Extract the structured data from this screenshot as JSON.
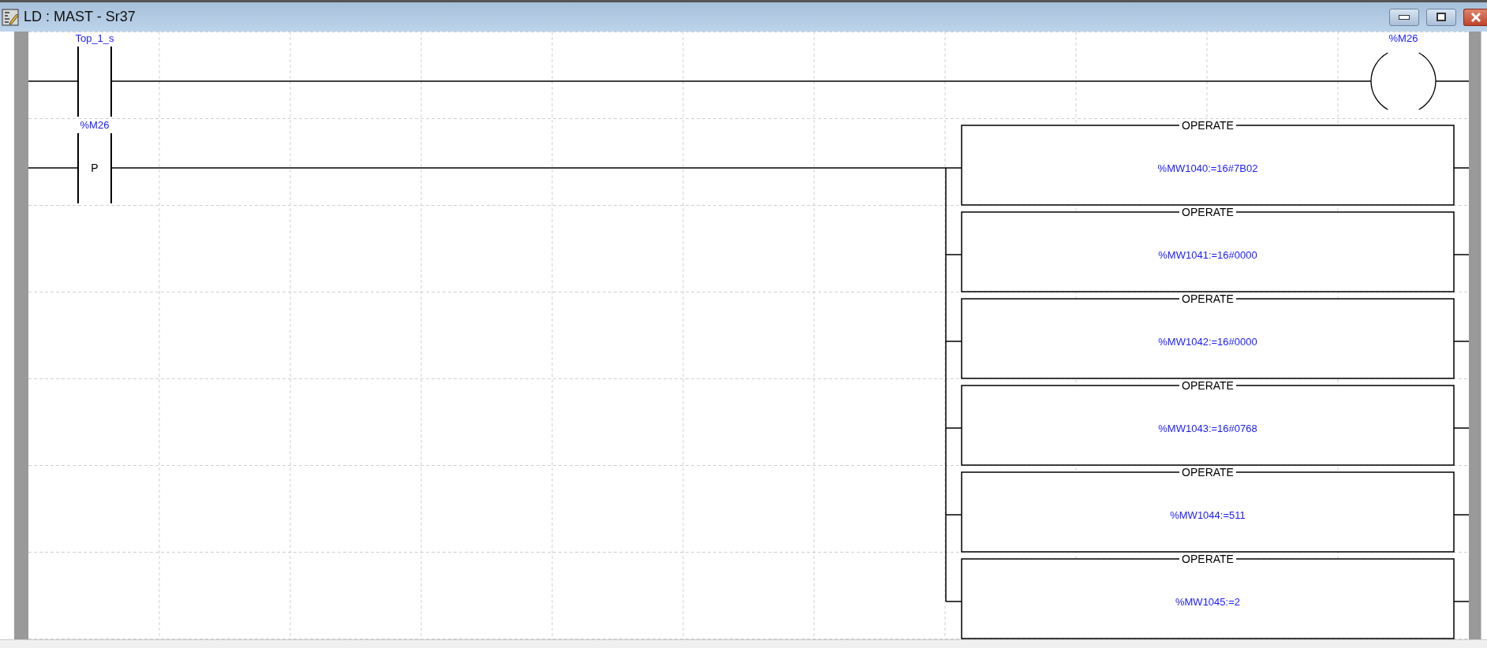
{
  "window": {
    "title": "LD : MAST - Sr37"
  },
  "rungs": [
    {
      "contact": {
        "label": "Top_1_s"
      },
      "coil": {
        "label": "%M26"
      }
    },
    {
      "contact": {
        "label": "%M26",
        "symbol": "P"
      },
      "blocks": [
        {
          "header": "OPERATE",
          "expression": "%MW1040:=16#7B02"
        },
        {
          "header": "OPERATE",
          "expression": "%MW1041:=16#0000"
        },
        {
          "header": "OPERATE",
          "expression": "%MW1042:=16#0000"
        },
        {
          "header": "OPERATE",
          "expression": "%MW1043:=16#0768"
        },
        {
          "header": "OPERATE",
          "expression": "%MW1044:=511"
        },
        {
          "header": "OPERATE",
          "expression": "%MW1045:=2"
        }
      ]
    }
  ]
}
